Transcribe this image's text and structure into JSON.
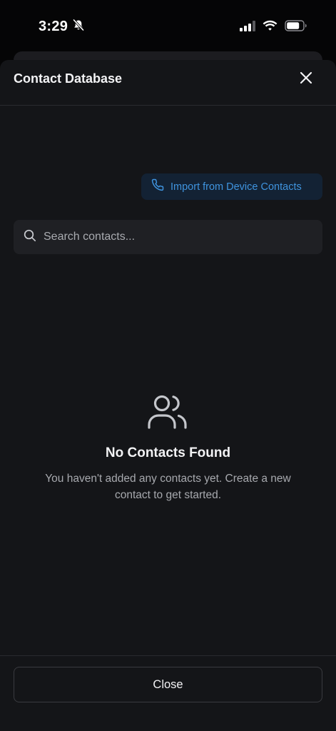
{
  "status_bar": {
    "time": "3:29",
    "mute_icon": "bell-slash-icon",
    "signal_icon": "cellular-signal-icon",
    "wifi_icon": "wifi-icon",
    "battery_icon": "battery-icon"
  },
  "modal": {
    "title": "Contact Database",
    "close_icon": "close-icon"
  },
  "import": {
    "label": "Import from Device Contacts",
    "icon": "phone-icon"
  },
  "search": {
    "placeholder": "Search contacts...",
    "value": "",
    "icon": "search-icon"
  },
  "empty_state": {
    "icon": "users-icon",
    "title": "No Contacts Found",
    "description": "You haven't added any contacts yet. Create a new contact to get started."
  },
  "footer": {
    "close_label": "Close"
  },
  "colors": {
    "accent": "#3f94df",
    "sheet_background": "#141518",
    "input_background": "#1f2024"
  }
}
